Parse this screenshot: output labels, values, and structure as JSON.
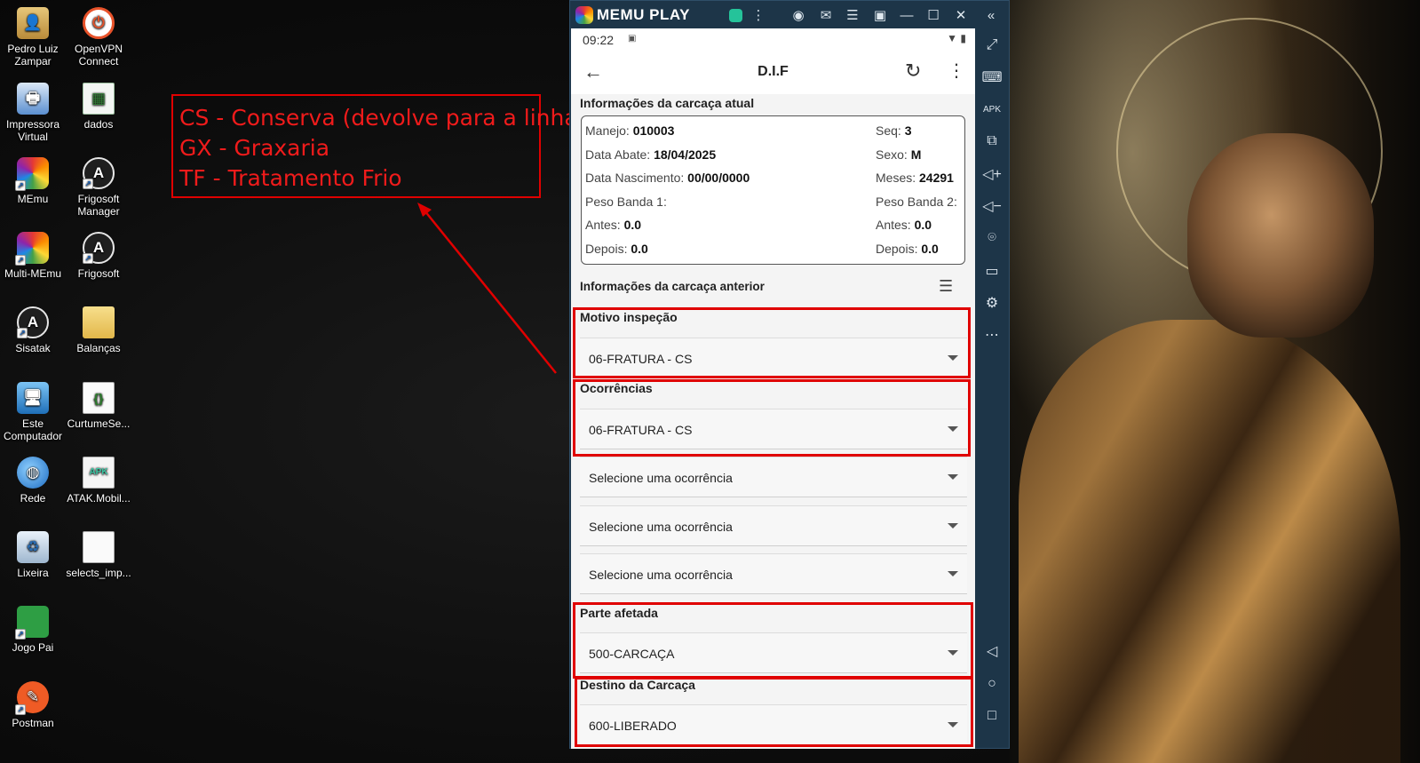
{
  "desktop": {
    "icons": [
      {
        "label": "Pedro Luiz\nZampar",
        "glyph": "👤",
        "icon": "user-folder-icon"
      },
      {
        "label": "OpenVPN\nConnect",
        "glyph": "⏻",
        "icon": "openvpn-icon"
      },
      {
        "label": "Impressora\nVirtual",
        "glyph": "🖶",
        "icon": "printer-icon"
      },
      {
        "label": "dados",
        "glyph": "▦",
        "icon": "spreadsheet-icon"
      },
      {
        "label": "MEmu",
        "glyph": "",
        "icon": "memu-icon"
      },
      {
        "label": "Frigosoft\nManager",
        "glyph": "A",
        "icon": "atak-icon"
      },
      {
        "label": "Multi-MEmu",
        "glyph": "",
        "icon": "multi-memu-icon"
      },
      {
        "label": "Frigosoft",
        "glyph": "A",
        "icon": "atak-icon"
      },
      {
        "label": "Sisatak",
        "glyph": "A",
        "icon": "atak-icon"
      },
      {
        "label": "Balanças",
        "glyph": "",
        "icon": "folder-icon"
      },
      {
        "label": "Este\nComputador",
        "glyph": "🖥",
        "icon": "computer-icon"
      },
      {
        "label": "CurtumeSe...",
        "glyph": "{}",
        "icon": "json-file-icon"
      },
      {
        "label": "Rede",
        "glyph": "◍",
        "icon": "network-icon"
      },
      {
        "label": "ATAK.Mobil...",
        "glyph": "APK",
        "icon": "apk-file-icon"
      },
      {
        "label": "Lixeira",
        "glyph": "♻",
        "icon": "recycle-bin-icon"
      },
      {
        "label": "selects_imp...",
        "glyph": "",
        "icon": "text-file-icon"
      },
      {
        "label": "Jogo Pai",
        "glyph": "",
        "icon": "folder-icon"
      },
      {
        "label": "Postman",
        "glyph": "✎",
        "icon": "postman-icon"
      }
    ]
  },
  "annotation": {
    "lines": [
      "CS - Conserva (devolve para a linha)",
      "GX - Graxaria",
      "TF - Tratamento Frio"
    ],
    "color": "#e00000"
  },
  "emulator": {
    "brand": "MEMU PLAY",
    "titlebar_icons": [
      "play-store-icon",
      "more-icon",
      "account-icon",
      "mail-icon",
      "menu-icon",
      "screenshot-icon",
      "minimize-icon",
      "maximize-icon",
      "close-icon",
      "collapse-icon"
    ],
    "sidebar_icons": [
      "fullscreen-icon",
      "keyboard-icon",
      "apk-install-icon",
      "multi-window-icon",
      "volume-up-icon",
      "volume-down-icon",
      "location-icon",
      "folder-icon",
      "settings-icon",
      "more-icon",
      "android-back-icon",
      "android-home-icon",
      "android-recents-icon"
    ]
  },
  "android": {
    "status_time": "09:22",
    "app_title": "D.I.F",
    "current_section_title": "Informações da carcaça atual",
    "current": {
      "manejo_label": "Manejo:",
      "manejo": "010003",
      "seq_label": "Seq:",
      "seq": "3",
      "data_abate_label": "Data Abate:",
      "data_abate": "18/04/2025",
      "sexo_label": "Sexo:",
      "sexo": "M",
      "data_nascimento_label": "Data Nascimento:",
      "data_nascimento": "00/00/0000",
      "meses_label": "Meses:",
      "meses": "24291",
      "peso_banda1_label": "Peso Banda 1:",
      "peso_banda2_label": "Peso Banda 2:",
      "antes1_label": "Antes:",
      "antes1": "0.0",
      "antes2_label": "Antes:",
      "antes2": "0.0",
      "depois1_label": "Depois:",
      "depois1": "0.0",
      "depois2_label": "Depois:",
      "depois2": "0.0"
    },
    "previous_section_title": "Informações da carcaça anterior",
    "motivo_label": "Motivo inspeção",
    "motivo_value": "06-FRATURA - CS",
    "ocorrencias_label": "Ocorrências",
    "ocorrencias_value": "06-FRATURA - CS",
    "ocorrencia_placeholder_1": "Selecione uma ocorrência",
    "ocorrencia_placeholder_2": "Selecione uma ocorrência",
    "ocorrencia_placeholder_3": "Selecione uma ocorrência",
    "parte_label": "Parte afetada",
    "parte_value": "500-CARCAÇA",
    "destino_label": "Destino da Carcaça",
    "destino_value": "600-LIBERADO"
  }
}
